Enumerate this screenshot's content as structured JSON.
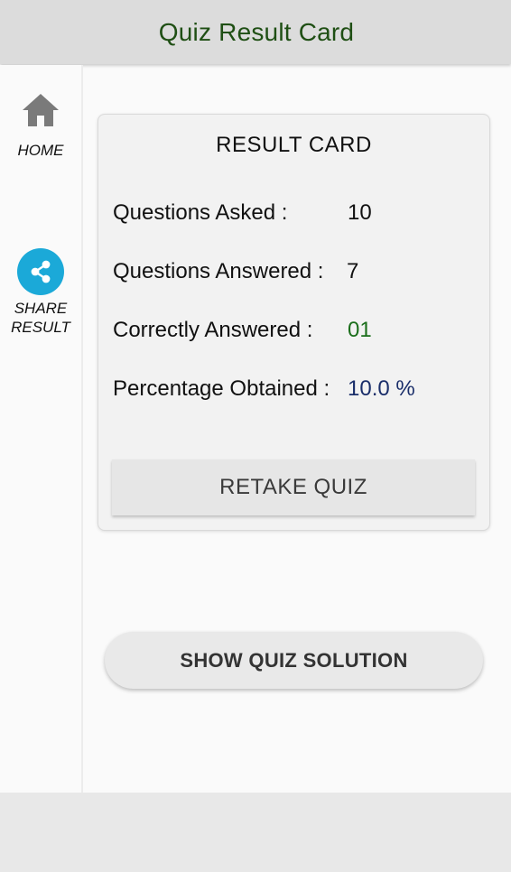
{
  "header": {
    "title": "Quiz Result Card"
  },
  "sidebar": {
    "home_label": "HOME",
    "share_label_line1": "SHARE",
    "share_label_line2": "RESULT"
  },
  "result_card": {
    "title": "RESULT CARD",
    "rows": [
      {
        "label": "Questions Asked :",
        "value": "10"
      },
      {
        "label": "Questions Answered :",
        "value": "7"
      },
      {
        "label": "Correctly Answered :",
        "value": "01"
      },
      {
        "label": "Percentage Obtained :",
        "value": "10.0 %"
      }
    ],
    "retake_label": "RETAKE QUIZ"
  },
  "show_solution_label": "SHOW QUIZ SOLUTION",
  "colors": {
    "title_green": "#1f4f14",
    "correct_green": "#1b6e1b",
    "percent_navy": "#1a2e6a",
    "share_blue": "#1ba9d8",
    "home_icon_gray": "#7a7a7a"
  },
  "icons": {
    "home": "home-icon",
    "share": "share-icon"
  }
}
